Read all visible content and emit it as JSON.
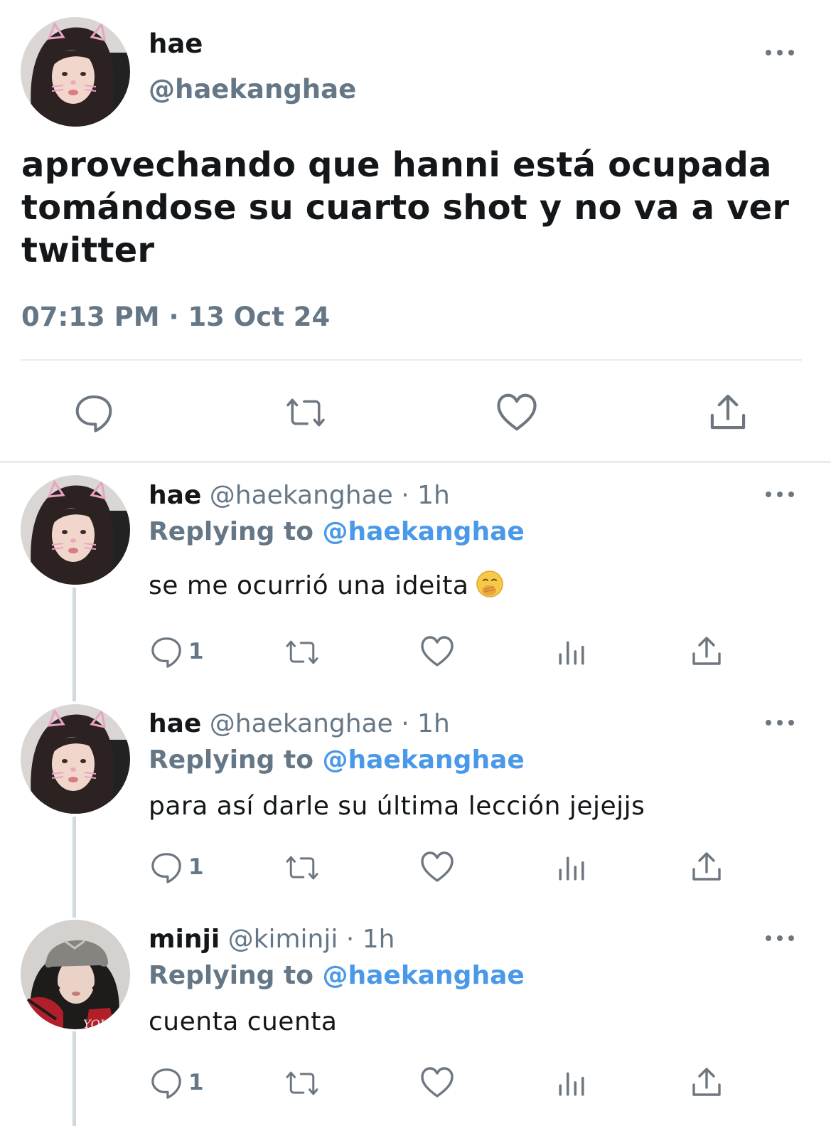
{
  "main_tweet": {
    "name": "hae",
    "handle": "@haekanghae",
    "text": "aprovechando que hanni está ocupada tomándose su cuarto shot y no va a ver twitter",
    "time": "07:13 PM",
    "separator": "·",
    "date": "13 Oct 24",
    "actions": [
      "reply-icon",
      "retweet-icon",
      "like-icon",
      "share-icon"
    ]
  },
  "replies": [
    {
      "name": "hae",
      "handle": "@haekanghae",
      "dot": "·",
      "time": "1h",
      "replying_prefix": "Replying to",
      "replying_handle": "@haekanghae",
      "text": "se me ocurrió una ideita",
      "emoji": "face-with-hand-over-mouth",
      "reply_count": "1"
    },
    {
      "name": "hae",
      "handle": "@haekanghae",
      "dot": "·",
      "time": "1h",
      "replying_prefix": "Replying to",
      "replying_handle": "@haekanghae",
      "text": "para así darle su última lección jejejjs",
      "reply_count": "1"
    },
    {
      "name": "minji",
      "handle": "@kiminji",
      "dot": "·",
      "time": "1h",
      "replying_prefix": "Replying to",
      "replying_handle": "@haekanghae",
      "text": "cuenta cuenta",
      "reply_count": "1"
    }
  ],
  "colors": {
    "text": "#14171a",
    "muted": "#657786",
    "link": "#4a99e9",
    "divider": "#e6ecf0",
    "icon": "#6e7781"
  }
}
